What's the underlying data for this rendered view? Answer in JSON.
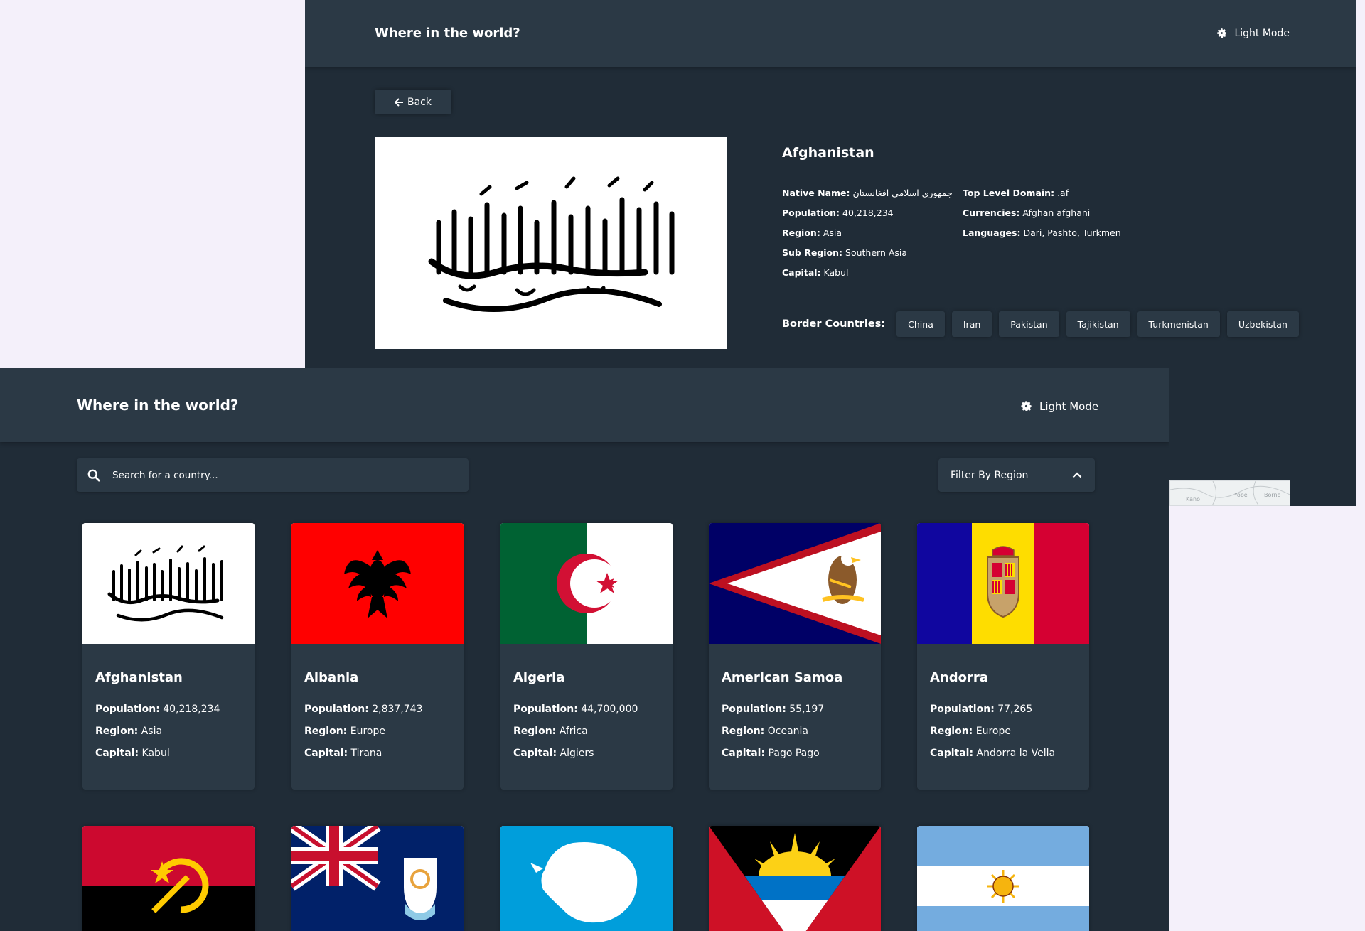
{
  "detail": {
    "app_title": "Where in the world?",
    "mode_label": "Light Mode",
    "back_label": "Back",
    "country": {
      "name": "Afghanistan",
      "native_name_label": "Native Name:",
      "native_name": "جمهوری اسلامی افغانستان",
      "population_label": "Population:",
      "population": "40,218,234",
      "region_label": "Region:",
      "region": "Asia",
      "sub_region_label": "Sub Region:",
      "sub_region": "Southern Asia",
      "capital_label": "Capital:",
      "capital": "Kabul",
      "tld_label": "Top Level Domain:",
      "tld": ".af",
      "currencies_label": "Currencies:",
      "currencies": "Afghan afghani",
      "languages_label": "Languages:",
      "languages": "Dari, Pashto, Turkmen"
    },
    "border_label": "Border Countries:",
    "borders": [
      "China",
      "Iran",
      "Pakistan",
      "Tajikistan",
      "Turkmenistan",
      "Uzbekistan"
    ],
    "map_labels": [
      "Kano",
      "Yobe",
      "Borno"
    ]
  },
  "home": {
    "app_title": "Where in the world?",
    "mode_label": "Light Mode",
    "search_placeholder": "Search for a country...",
    "filter_label": "Filter By Region",
    "labels": {
      "population": "Population:",
      "region": "Region:",
      "capital": "Capital:"
    },
    "countries": [
      {
        "name": "Afghanistan",
        "population": "40,218,234",
        "region": "Asia",
        "capital": "Kabul"
      },
      {
        "name": "Albania",
        "population": "2,837,743",
        "region": "Europe",
        "capital": "Tirana"
      },
      {
        "name": "Algeria",
        "population": "44,700,000",
        "region": "Africa",
        "capital": "Algiers"
      },
      {
        "name": "American Samoa",
        "population": "55,197",
        "region": "Oceania",
        "capital": "Pago Pago"
      },
      {
        "name": "Andorra",
        "population": "77,265",
        "region": "Europe",
        "capital": "Andorra la Vella"
      }
    ],
    "second_row_flags": [
      "angola-flag",
      "anguilla-flag",
      "antarctica-flag",
      "antigua-and-barbuda-flag",
      "argentina-flag"
    ]
  },
  "colors": {
    "background": "#202c37",
    "elements": "#2b3945",
    "text": "#ffffff",
    "outside": "#f4f0fa"
  }
}
